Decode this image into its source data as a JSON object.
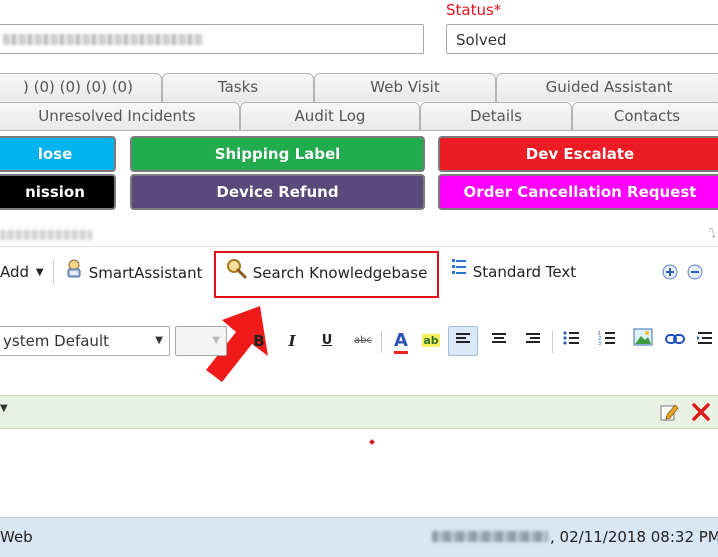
{
  "status": {
    "label": "Status*",
    "value": "Solved"
  },
  "tabs_row1": [
    {
      "label": ") (0) (0) (0) (0)"
    },
    {
      "label": "Tasks"
    },
    {
      "label": "Web Visit"
    },
    {
      "label": "Guided Assistant"
    }
  ],
  "tabs_row2": [
    {
      "label": "Unresolved Incidents"
    },
    {
      "label": "Audit Log"
    },
    {
      "label": "Details"
    },
    {
      "label": "Contacts"
    }
  ],
  "actions_row1": [
    {
      "label": "lose",
      "color": "#00b4f0"
    },
    {
      "label": "Shipping Label",
      "color": "#21ad4e"
    },
    {
      "label": "Dev Escalate",
      "color": "#ed1c24"
    }
  ],
  "actions_row2": [
    {
      "label": "nission",
      "color": "#000000"
    },
    {
      "label": "Device Refund",
      "color": "#5a4a7b"
    },
    {
      "label": "Order Cancellation Request",
      "color": "#ff00ff"
    }
  ],
  "toolbar": {
    "add_label": "Add",
    "smart_assistant_label": "SmartAssistant",
    "search_kb_label": "Search Knowledgebase",
    "standard_text_label": "Standard Text"
  },
  "format": {
    "font_value": "ystem Default",
    "bold": "B",
    "italic": "I",
    "underline": "U",
    "strike": "abc",
    "text_color": "A",
    "highlight": "ab"
  },
  "footer": {
    "left_text": "Web",
    "datetime": ", 02/11/2018 08:32 PM"
  }
}
